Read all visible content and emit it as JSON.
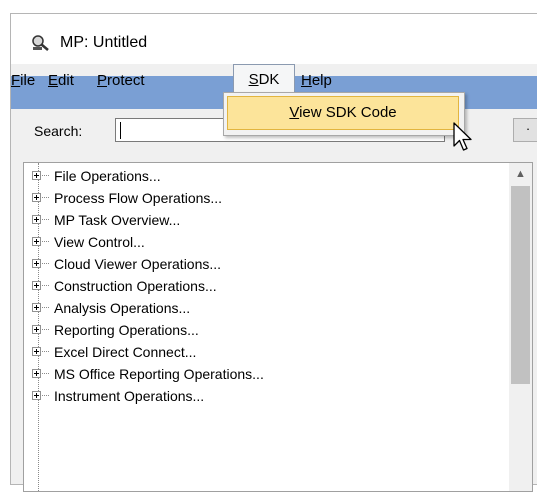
{
  "window": {
    "title": "MP: Untitled",
    "icon": "magnifier-app-icon"
  },
  "menubar": {
    "items": [
      {
        "label": "File",
        "mnemonic": "F",
        "rest": "ile"
      },
      {
        "label": "Edit",
        "mnemonic": "E",
        "rest": "dit"
      },
      {
        "label": "Protect",
        "mnemonic": "P",
        "rest": "rotect"
      },
      {
        "label": "SDK",
        "mnemonic": "S",
        "rest": "DK",
        "open": true
      },
      {
        "label": "Help",
        "mnemonic": "H",
        "rest": "elp"
      }
    ]
  },
  "dropdown": {
    "item": {
      "label": "View SDK Code",
      "mnemonic": "V",
      "rest": "iew SDK Code"
    }
  },
  "search": {
    "label": "Search:",
    "value": ""
  },
  "right_button": {
    "label": "·"
  },
  "tree": {
    "items": [
      "File Operations...",
      "Process Flow Operations...",
      "MP Task Overview...",
      "View Control...",
      "Cloud Viewer Operations...",
      "Construction Operations...",
      "Analysis Operations...",
      "Reporting Operations...",
      "Excel Direct Connect...",
      "MS Office Reporting Operations...",
      "Instrument Operations..."
    ]
  },
  "colors": {
    "menubar_bg": "#7a9fd4",
    "highlight": "#fce49a",
    "highlight_border": "#e2b53f"
  }
}
